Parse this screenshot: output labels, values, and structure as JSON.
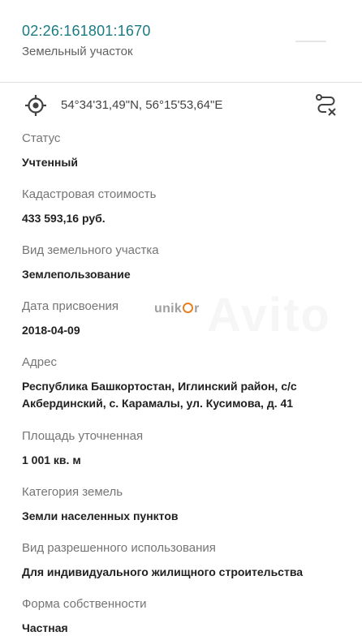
{
  "header": {
    "cadastral_number": "02:26:161801:1670",
    "object_type": "Земельный участок"
  },
  "location": {
    "coordinates": "54°34'31,49\"N, 56°15'53,64\"E",
    "locate_icon": "crosshair-icon",
    "route_icon": "route-off-icon"
  },
  "fields": [
    {
      "label": "Статус",
      "value": "Учтенный"
    },
    {
      "label": "Кадастровая стоимость",
      "value": "433 593,16 руб."
    },
    {
      "label": "Вид земельного участка",
      "value": "Землепользование"
    },
    {
      "label": "Дата присвоения",
      "value": "2018-04-09"
    },
    {
      "label": "Адрес",
      "value": "Республика Башкортостан, Иглинский район, с/с Акбердинский, с. Карамалы, ул. Кусимова, д. 41"
    },
    {
      "label": "Площадь уточненная",
      "value": "1 001 кв. м"
    },
    {
      "label": "Категория земель",
      "value": "Земли населенных пунктов"
    },
    {
      "label": "Вид разрешенного использования",
      "value": "Для индивидуального жилищного строительства"
    },
    {
      "label": "Форма собственности",
      "value": "Частная"
    }
  ],
  "watermark": {
    "left": "unik",
    "right": "r"
  },
  "colors": {
    "accent": "#1a7a82",
    "label": "#757575",
    "value": "#212121"
  }
}
